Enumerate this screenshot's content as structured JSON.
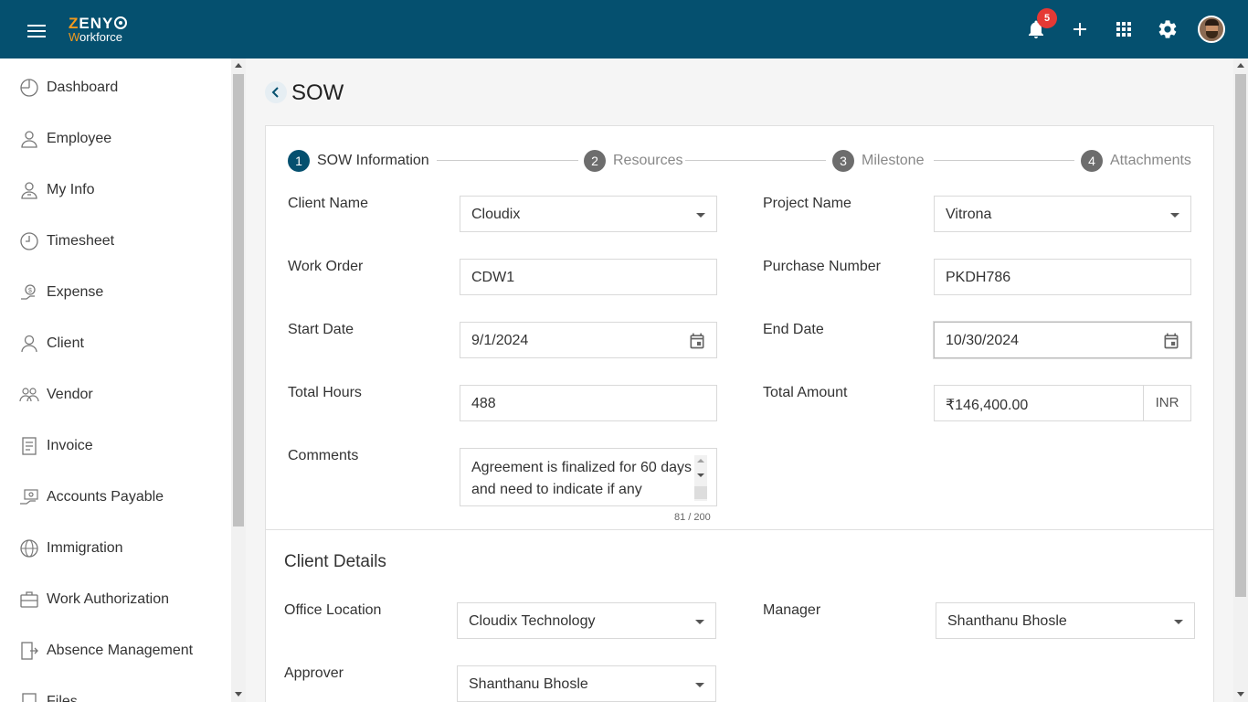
{
  "app": {
    "logo_top": "ZENY",
    "logo_bottom_first": "W",
    "logo_bottom_rest": "orkforce",
    "notification_count": "5"
  },
  "sidebar": {
    "items": [
      {
        "label": "Dashboard",
        "icon": "dashboard-icon"
      },
      {
        "label": "Employee",
        "icon": "employee-icon"
      },
      {
        "label": "My Info",
        "icon": "my-info-icon"
      },
      {
        "label": "Timesheet",
        "icon": "clock-icon"
      },
      {
        "label": "Expense",
        "icon": "expense-icon"
      },
      {
        "label": "Client",
        "icon": "client-icon"
      },
      {
        "label": "Vendor",
        "icon": "vendor-icon"
      },
      {
        "label": "Invoice",
        "icon": "invoice-icon"
      },
      {
        "label": "Accounts Payable",
        "icon": "accounts-payable-icon"
      },
      {
        "label": "Immigration",
        "icon": "globe-icon"
      },
      {
        "label": "Work Authorization",
        "icon": "briefcase-icon"
      },
      {
        "label": "Absence Management",
        "icon": "exit-door-icon"
      },
      {
        "label": "Files",
        "icon": "files-icon"
      }
    ]
  },
  "page": {
    "title": "SOW"
  },
  "stepper": {
    "steps": [
      {
        "num": "1",
        "label": "SOW Information"
      },
      {
        "num": "2",
        "label": "Resources"
      },
      {
        "num": "3",
        "label": "Milestone"
      },
      {
        "num": "4",
        "label": "Attachments"
      }
    ]
  },
  "form": {
    "client_name": {
      "label": "Client Name",
      "value": "Cloudix"
    },
    "project_name": {
      "label": "Project Name",
      "value": "Vitrona"
    },
    "work_order": {
      "label": "Work Order",
      "value": "CDW1"
    },
    "purchase_number": {
      "label": "Purchase Number",
      "value": "PKDH786"
    },
    "start_date": {
      "label": "Start Date",
      "value": "9/1/2024"
    },
    "end_date": {
      "label": "End Date",
      "value": "10/30/2024"
    },
    "total_hours": {
      "label": "Total Hours",
      "value": "488"
    },
    "total_amount": {
      "label": "Total Amount",
      "value": "₹146,400.00",
      "currency": "INR"
    },
    "comments": {
      "label": "Comments",
      "value": "Agreement is finalized for 60 days and need to indicate if any",
      "counter": "81 / 200"
    }
  },
  "client_details": {
    "title": "Client Details",
    "office_location": {
      "label": "Office Location",
      "value": "Cloudix Technology"
    },
    "manager": {
      "label": "Manager",
      "value": "Shanthanu Bhosle"
    },
    "approver": {
      "label": "Approver",
      "value": "Shanthanu Bhosle"
    }
  },
  "colors": {
    "header_bg": "#05506f",
    "accent": "#05506f",
    "logo_accent": "#f39a1d",
    "badge": "#e53935"
  }
}
